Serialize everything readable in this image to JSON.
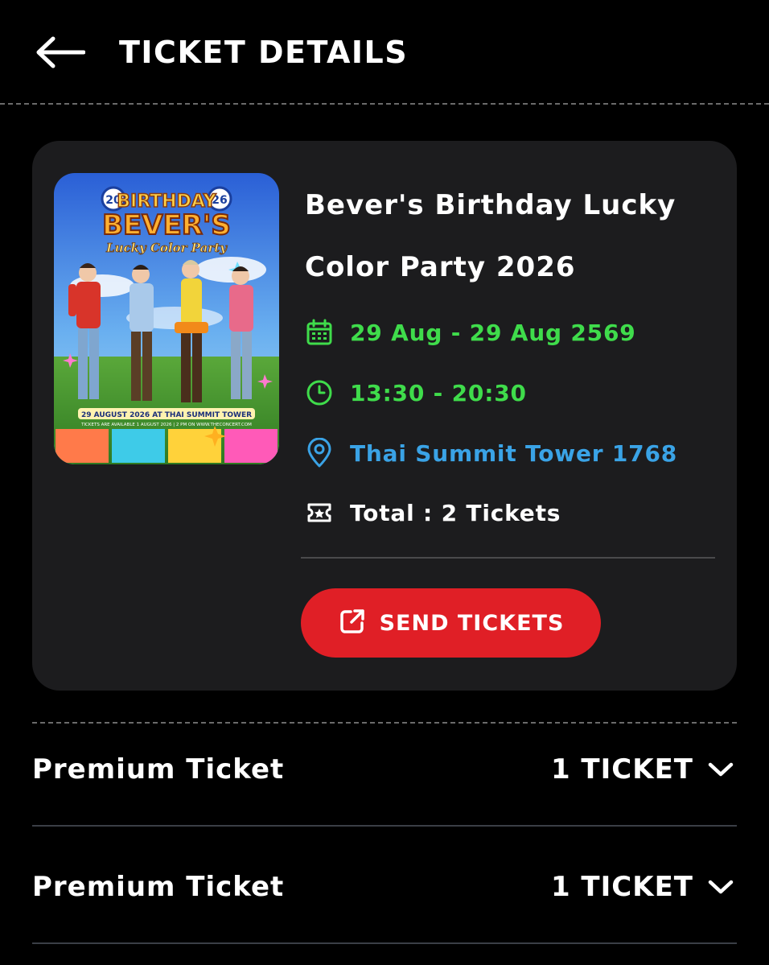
{
  "header": {
    "title": "TICKET DETAILS"
  },
  "event": {
    "title_line1": "Bever's Birthday Lucky",
    "title_line2": "Color Party 2026",
    "date": "29 Aug - 29 Aug 2569",
    "time": "13:30 - 20:30",
    "venue": "Thai Summit Tower 1768",
    "total": "Total : 2 Tickets",
    "poster": {
      "badge_left": "20",
      "badge_right": "26",
      "headline1": "BIRTHDAY",
      "headline2": "BEVER'S",
      "tagline": "Lucky Color Party",
      "banner": "29 AUGUST 2026 AT THAI SUMMIT TOWER",
      "footer": "TICKETS ARE AVAILABLE 1 AUGUST 2026 | 2 PM ON  WWW.THECONCERT.COM"
    }
  },
  "actions": {
    "send_label": "SEND TICKETS"
  },
  "tickets": [
    {
      "name": "Premium Ticket",
      "count": "1 TICKET"
    },
    {
      "name": "Premium Ticket",
      "count": "1 TICKET"
    }
  ],
  "icons": {
    "back": "arrow-left-icon",
    "date": "calendar-icon",
    "time": "clock-icon",
    "venue": "location-pin-icon",
    "total": "ticket-icon",
    "send": "external-link-icon",
    "expand": "chevron-down-icon"
  },
  "colors": {
    "background": "#000000",
    "card": "#1c1c1e",
    "accent_red": "#e01f26",
    "date_time_green": "#3fdc4b",
    "venue_blue": "#3aa3e6"
  }
}
